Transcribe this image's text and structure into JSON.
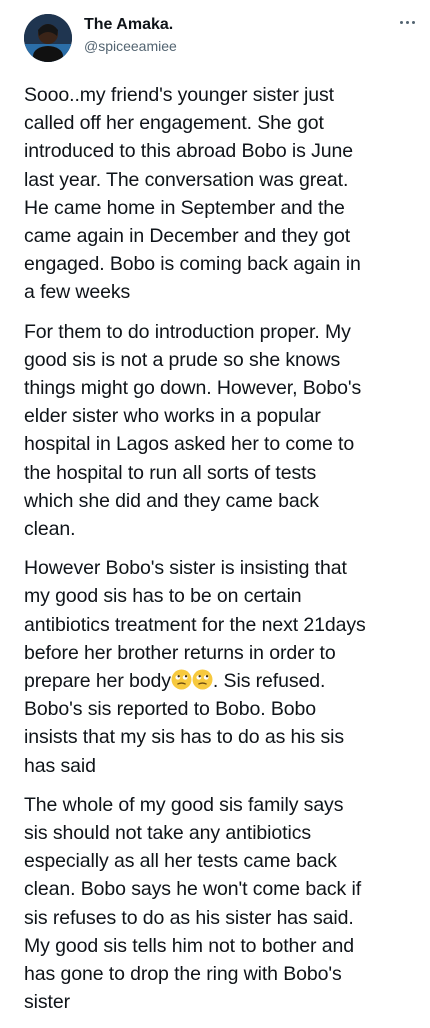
{
  "author": {
    "name": "The Amaka.",
    "handle": "@spiceeamiee",
    "avatar_icon": "profile-photo"
  },
  "menu": {
    "icon": "more-options-icon"
  },
  "tweet": {
    "paragraphs": [
      "Sooo..my friend's younger sister just\ncalled off her engagement. She got\nintroduced to this abroad Bobo is June\nlast year. The conversation was great.\nHe came home in September and the\ncame again in December and they got\nengaged. Bobo is coming back again in\na few weeks",
      "For them to do introduction proper. My\ngood sis is not a prude so she knows\nthings might go down. However, Bobo's\nelder sister who works in a popular\nhospital in Lagos asked her to come to\nthe hospital to run all sorts of tests\nwhich she did and they came back\nclean.",
      "",
      "The whole of my good sis family says\nsis should not take any antibiotics\nespecially as all her tests came back\nclean. Bobo says he won't come back if\nsis refuses to do as his sister has said.\nMy good sis tells him not to bother and\nhas gone to drop the ring with Bobo's\nsister"
    ],
    "p3_before_emoji": "However Bobo's sister is insisting that\nmy good sis has to be on certain\nantibiotics treatment for the next 21days\nbefore her brother returns in order to\nprepare her body",
    "p3_emojis": [
      "eye-roll-emoji",
      "eye-roll-emoji"
    ],
    "p3_after_emoji": ". Sis refused.\nBobo's sis reported to Bobo. Bobo\ninsists that my sis has to do as his sis\nhas said"
  }
}
